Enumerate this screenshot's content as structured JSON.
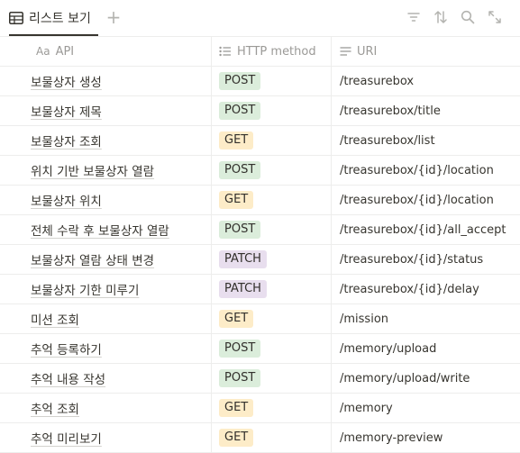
{
  "view": {
    "label": "리스트 보기",
    "icon": "table-icon",
    "add_label": "+"
  },
  "toolbar_icons": [
    "filter-icon",
    "sort-icon",
    "search-icon",
    "expand-icon"
  ],
  "columns": {
    "name": "API",
    "name_icon_text": "Aa",
    "method": "HTTP method",
    "uri": "URI"
  },
  "method_colors": {
    "POST": "#dbeddb",
    "GET": "#fdecc8",
    "PATCH": "#e8deee"
  },
  "rows": [
    {
      "name": "보물상자 생성",
      "method": "POST",
      "uri": "/treasurebox"
    },
    {
      "name": "보물상자 제목",
      "method": "POST",
      "uri": "/treasurebox/title"
    },
    {
      "name": "보물상자 조회",
      "method": "GET",
      "uri": "/treasurebox/list"
    },
    {
      "name": "위치 기반 보물상자 열람",
      "method": "POST",
      "uri": "/treasurebox/{id}/location"
    },
    {
      "name": "보물상자 위치",
      "method": "GET",
      "uri": "/treasurebox/{id}/location"
    },
    {
      "name": "전체 수락 후 보물상자 열람",
      "method": "POST",
      "uri": "/treasurebox/{id}/all_accept"
    },
    {
      "name": "보물상자 열람 상태 변경",
      "method": "PATCH",
      "uri": "/treasurebox/{id}/status"
    },
    {
      "name": "보물상자 기한 미루기",
      "method": "PATCH",
      "uri": "/treasurebox/{id}/delay"
    },
    {
      "name": "미션 조회",
      "method": "GET",
      "uri": "/mission"
    },
    {
      "name": "추억 등록하기",
      "method": "POST",
      "uri": "/memory/upload"
    },
    {
      "name": "추억 내용 작성",
      "method": "POST",
      "uri": "/memory/upload/write"
    },
    {
      "name": "추억 조회",
      "method": "GET",
      "uri": "/memory"
    },
    {
      "name": "추억 미리보기",
      "method": "GET",
      "uri": "/memory-preview"
    }
  ]
}
